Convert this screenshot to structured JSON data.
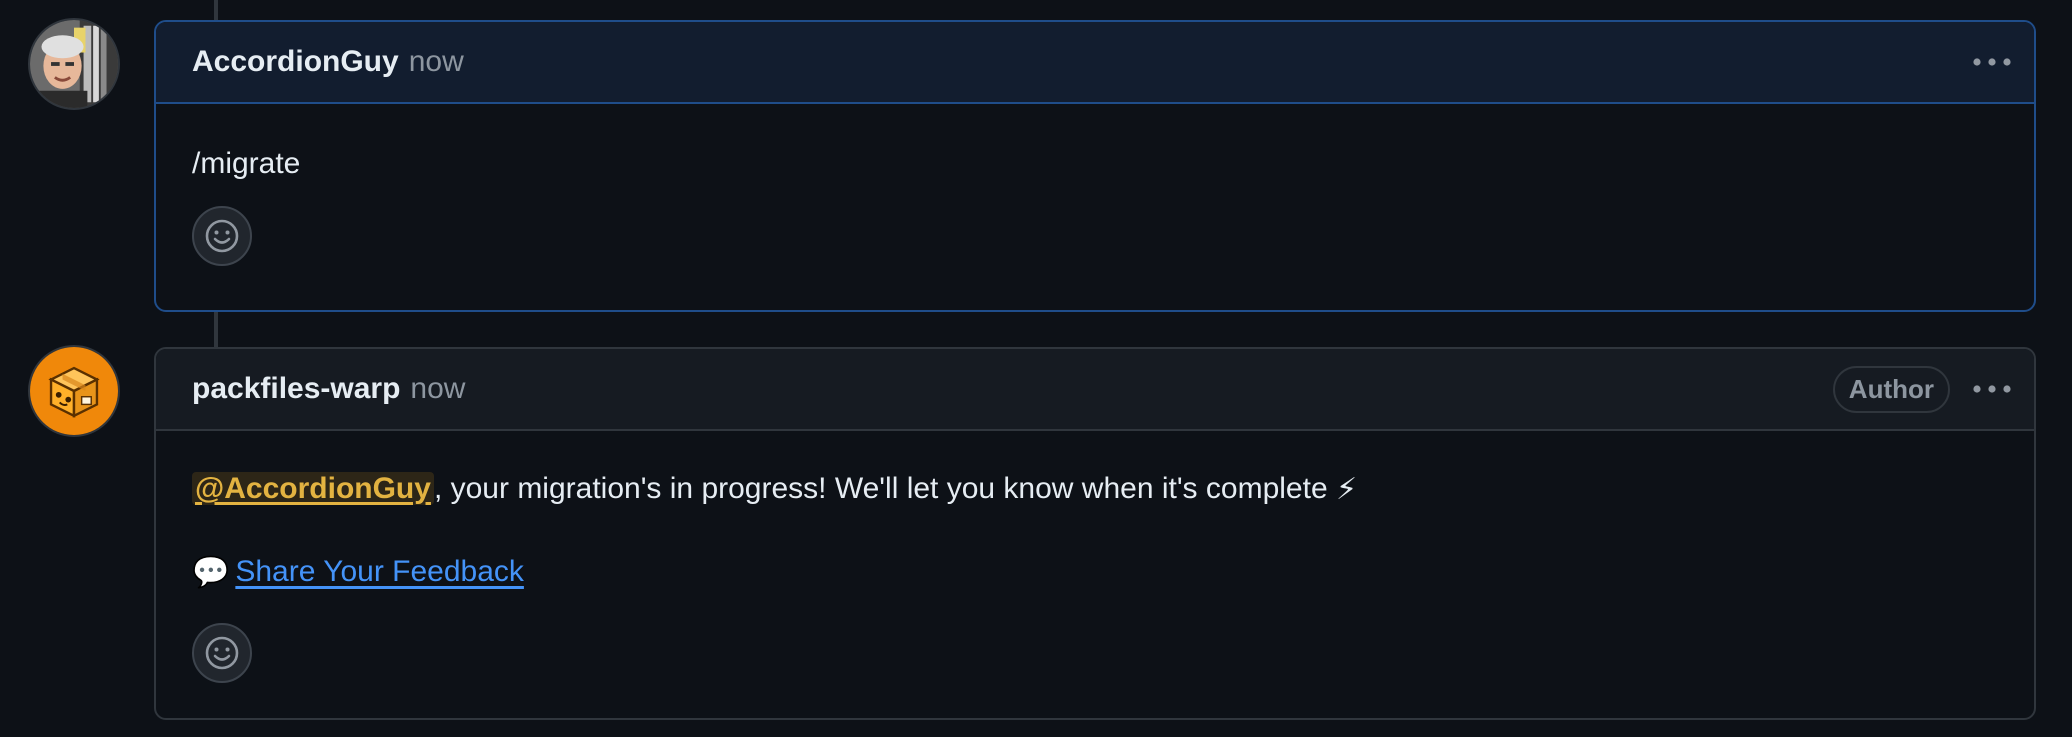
{
  "comments": [
    {
      "author": "AccordionGuy",
      "timestamp": "now",
      "avatar_icon": "user-photo-avatar",
      "body": "/migrate"
    },
    {
      "author": "packfiles-warp",
      "timestamp": "now",
      "avatar_icon": "orange-box-bot-avatar",
      "badge": "Author",
      "mention": "@AccordionGuy",
      "message": ", your migration's in progress! We'll let you know when it's complete",
      "message_emoji": "⚡",
      "feedback_emoji": "💬",
      "feedback_link": "Share Your Feedback"
    }
  ],
  "colors": {
    "background": "#0d1117",
    "highlight_border": "#1f4d8a",
    "border": "#30363d",
    "link": "#4493f8",
    "mention": "#e3b341",
    "bot_avatar": "#f0880a"
  }
}
